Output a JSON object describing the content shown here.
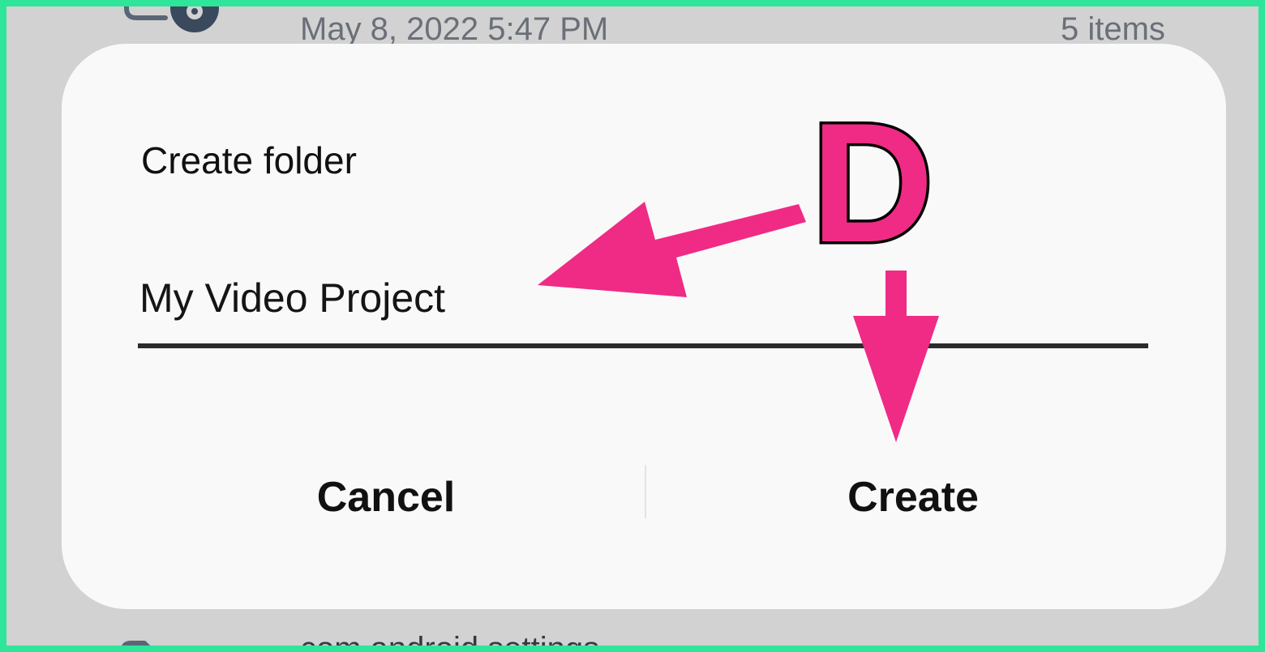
{
  "background_list": {
    "top_row": {
      "date": "May 8, 2022 5:47 PM",
      "item_count": "5 items",
      "icon": "folder-gear-icon"
    },
    "bottom_row": {
      "name": "com.android.settings",
      "icon": "folder-icon"
    }
  },
  "dialog": {
    "title": "Create folder",
    "input_value": "My Video Project",
    "cancel_label": "Cancel",
    "create_label": "Create"
  },
  "annotation": {
    "letter": "D",
    "color": "#ef2b85",
    "frame_color": "#2ee59a"
  }
}
